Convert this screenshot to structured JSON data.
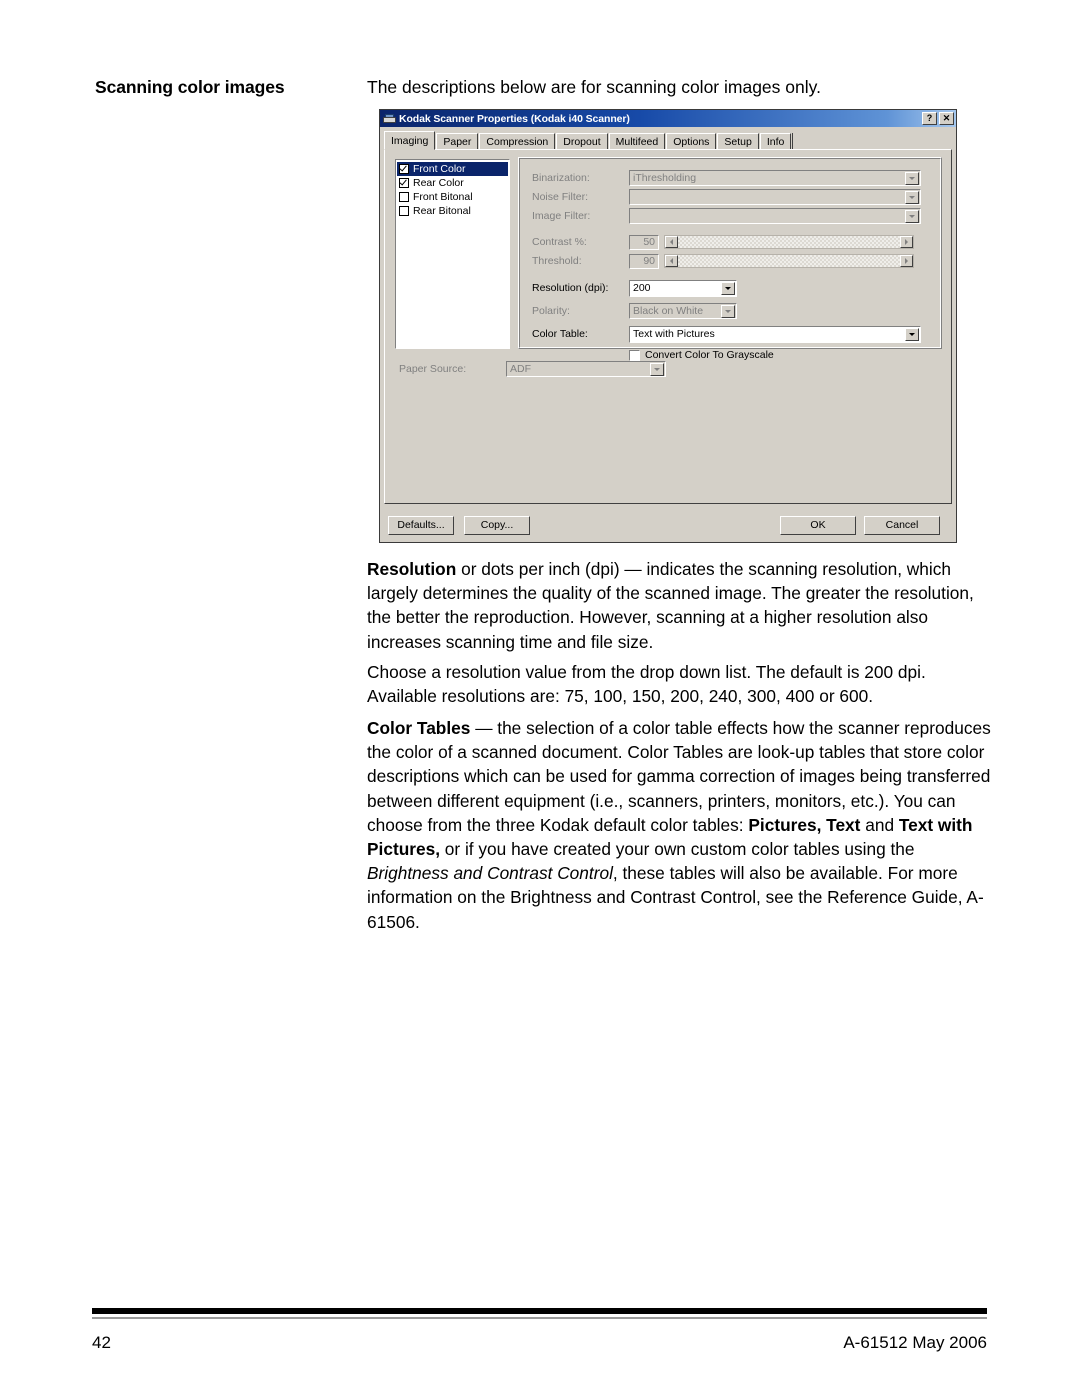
{
  "page": {
    "section_heading": "Scanning color images",
    "intro": "The descriptions below are for scanning color images only.",
    "footer": {
      "page_number": "42",
      "doc_id": "A-61512 May 2006"
    }
  },
  "body": {
    "para_resolution_bold": "Resolution",
    "para_resolution_rest": " or dots per inch (dpi) — indicates the scanning resolution, which largely determines the quality of the scanned image. The greater the resolution, the better the reproduction. However, scanning at a higher resolution also increases scanning time and file size.",
    "para_choose": "Choose a resolution value from the drop down list. The default is 200 dpi. Available resolutions are: 75, 100, 150, 200, 240, 300, 400 or 600.",
    "para_colortable_bold": "Color Tables",
    "para_colortable_seg1": " — the selection of a color table effects how the scanner reproduces the color of a scanned document. Color Tables are look-up tables that store color descriptions which can be used for gamma correction of images being transferred between different equipment (i.e., scanners, printers, monitors, etc.). You can choose from the three Kodak default color tables: ",
    "para_colortable_b1": "Pictures, Text",
    "para_colortable_seg2": " and ",
    "para_colortable_b2": "Text with Pictures,",
    "para_colortable_seg3": " or if you have created your own custom color tables using the ",
    "para_colortable_i1": "Brightness and Contrast Control",
    "para_colortable_seg4": ", these tables will also be available. For more information on the Brightness and Contrast Control, see the Reference Guide, A-61506."
  },
  "dialog": {
    "title": "Kodak Scanner Properties (Kodak i40 Scanner)",
    "titlebar_buttons": {
      "help": "?",
      "close": "✕"
    },
    "tabs": [
      {
        "label": "Imaging",
        "active": true
      },
      {
        "label": "Paper",
        "active": false
      },
      {
        "label": "Compression",
        "active": false
      },
      {
        "label": "Dropout",
        "active": false
      },
      {
        "label": "Multifeed",
        "active": false
      },
      {
        "label": "Options",
        "active": false
      },
      {
        "label": "Setup",
        "active": false
      },
      {
        "label": "Info",
        "active": false
      }
    ],
    "side_list": [
      {
        "label": "Front Color",
        "checked": true,
        "selected": true
      },
      {
        "label": "Rear Color",
        "checked": true,
        "selected": false
      },
      {
        "label": "Front Bitonal",
        "checked": false,
        "selected": false
      },
      {
        "label": "Rear Bitonal",
        "checked": false,
        "selected": false
      }
    ],
    "fields": {
      "binarization": {
        "label": "Binarization:",
        "value": "iThresholding",
        "enabled": false
      },
      "noise_filter": {
        "label": "Noise Filter:",
        "value": "",
        "enabled": false
      },
      "image_filter": {
        "label": "Image Filter:",
        "value": "",
        "enabled": false
      },
      "contrast": {
        "label": "Contrast %:",
        "value": "50",
        "enabled": false
      },
      "threshold": {
        "label": "Threshold:",
        "value": "90",
        "enabled": false
      },
      "resolution": {
        "label": "Resolution (dpi):",
        "value": "200",
        "enabled": true
      },
      "polarity": {
        "label": "Polarity:",
        "value": "Black on White",
        "enabled": false
      },
      "color_table": {
        "label": "Color Table:",
        "value": "Text with Pictures",
        "enabled": true
      },
      "convert_gray": {
        "label": "Convert Color To Grayscale",
        "checked": false,
        "enabled": true
      },
      "paper_source": {
        "label": "Paper Source:",
        "value": "ADF",
        "enabled": false
      }
    },
    "buttons": {
      "defaults": "Defaults...",
      "copy": "Copy...",
      "ok": "OK",
      "cancel": "Cancel"
    }
  }
}
